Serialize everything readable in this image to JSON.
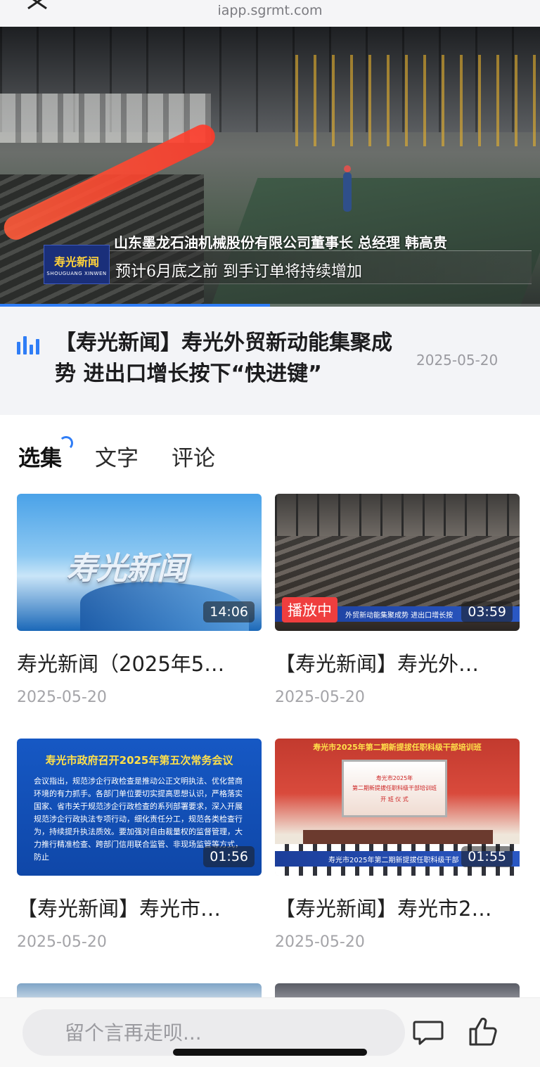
{
  "browser": {
    "url": "iapp.sgrmt.com"
  },
  "player": {
    "logo_zh": "寿光新闻",
    "logo_en": "SHOUGUANG XINWEN",
    "caption_line1": "山东墨龙石油机械股份有限公司董事长 总经理  韩高贵",
    "caption_line2": "预计6月底之前 到手订单将持续增加",
    "progress": 0.5
  },
  "video": {
    "title": "【寿光新闻】寿光外贸新动能集聚成势 进出口增长按下“快进键”",
    "date": "2025-05-20"
  },
  "tabs": [
    {
      "label": "选集"
    },
    {
      "label": "文字"
    },
    {
      "label": "评论"
    }
  ],
  "episodes": [
    {
      "title": "寿光新闻（2025年5…",
      "date": "2025-05-20",
      "duration": "14:06",
      "thumb_text": "寿光新闻"
    },
    {
      "title": "【寿光新闻】寿光外…",
      "date": "2025-05-20",
      "duration": "03:59",
      "status": "播放中",
      "strip_text": "外贸新动能集聚成势  进出口增长按"
    },
    {
      "title": "【寿光新闻】寿光市…",
      "date": "2025-05-20",
      "duration": "01:56",
      "thumb_head": "寿光市政府召开2025年第五次常务会议",
      "thumb_body": "会议指出，规范涉企行政检查是推动公正文明执法、优化营商环境的有力抓手。各部门单位要切实提高思想认识，严格落实国家、省市关于规范涉企行政检查的系列部署要求，深入开展规范涉企行政执法专项行动，细化责任分工，规范各类检查行为，持续提升执法质效。要加强对自由裁量权的监督管理，大力推行精准检查、跨部门信用联合监管、非现场监管等方式，防止"
    },
    {
      "title": "【寿光新闻】寿光市2…",
      "date": "2025-05-20",
      "duration": "01:55",
      "thumb_banner": "寿光市2025年第二期新提拔任职科级干部培训班",
      "screen_l1": "寿光市2025年",
      "screen_l2": "第二期新提拔任职科级干部培训班",
      "screen_l3": "开 班 仪 式",
      "strip_text": "寿光市2025年第二期新提拔任职科级干部"
    }
  ],
  "comment": {
    "placeholder": "留个言再走呗..."
  },
  "icons": {
    "close": "close-icon",
    "stats": "bar-chart-icon",
    "comment": "comment-icon",
    "like": "thumbs-up-icon"
  },
  "colors": {
    "accent": "#2f7df6",
    "playing_badge": "#ef3e3e"
  }
}
